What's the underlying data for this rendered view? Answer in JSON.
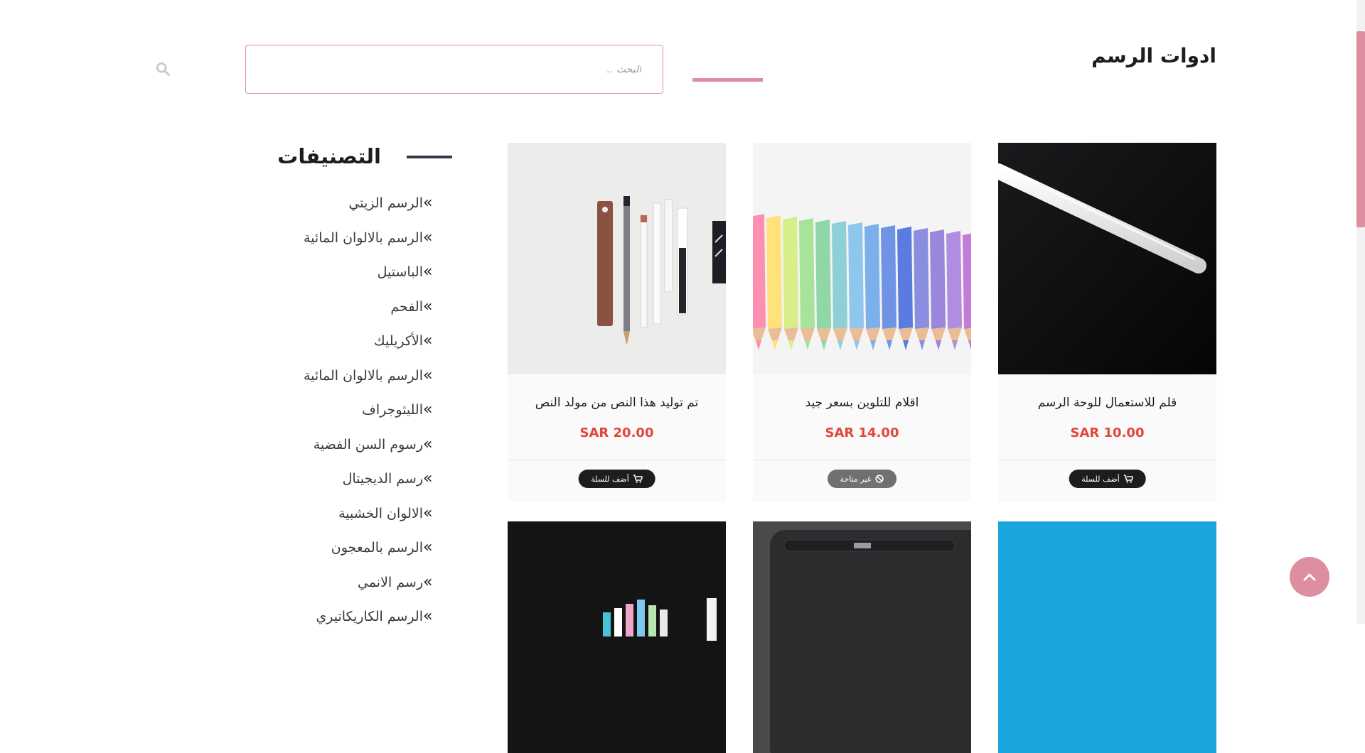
{
  "page": {
    "title": "ادوات الرسم"
  },
  "search": {
    "placeholder": "البحث .."
  },
  "sidebar": {
    "heading": "التصنيفات",
    "arrow": "«",
    "categories": [
      "الرسم الزيتي",
      "الرسم بالالوان المائية",
      "الباستيل",
      "الفحم",
      "الأكريليك",
      "الرسم بالالوان المائية",
      "الليثوجراف",
      "رسوم السن الفضية",
      "رسم الديجيتال",
      "الالوان الخشبية",
      "الرسم بالمعجون",
      "رسم الانمي",
      "الرسم الكاريكاتيري"
    ]
  },
  "products": [
    {
      "name": "قلم للاستعمال للوحة الرسم",
      "price": "SAR 10.00",
      "button": "أضف للسلة",
      "available": true
    },
    {
      "name": "اقلام للتلوين بسعر جيد",
      "price": "SAR 14.00",
      "button": "غير متاحة",
      "available": false
    },
    {
      "name": "تم توليد هذا النص من مولد النص",
      "price": "SAR 20.00",
      "button": "أضف للسلة",
      "available": true
    }
  ],
  "icons": {
    "search": "search-icon",
    "cart": "cart-icon",
    "unavailable": "ban-icon",
    "back_to_top": "chevron-up-icon"
  },
  "colors": {
    "accent": "#dd8e9f",
    "price": "#e2463a",
    "dark": "#1d1d1d",
    "button_disabled": "#707070"
  }
}
